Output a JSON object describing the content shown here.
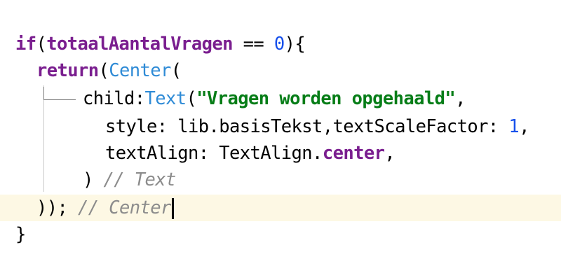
{
  "code": {
    "line1": {
      "kw_if": "if",
      "open": "(",
      "var": "totaalAantalVragen",
      "op": " == ",
      "num": "0",
      "close": "){"
    },
    "line2": {
      "kw_return": "return",
      "open": "(",
      "cls": "Center",
      "paren": "("
    },
    "line3": {
      "param": "child:",
      "cls": "Text",
      "paren": "(",
      "str": "\"Vragen worden opgehaald\"",
      "comma": ","
    },
    "line4": {
      "param": "style: lib.basisTekst,textScaleFactor: ",
      "num": "1",
      "comma": ","
    },
    "line5": {
      "param": "textAlign: TextAlign.",
      "field": "center",
      "comma": ","
    },
    "line6": {
      "close": ") ",
      "comment": "// Text"
    },
    "line7": {
      "close": ")); ",
      "comment": "// Center"
    },
    "line8": {
      "brace": "}"
    }
  }
}
